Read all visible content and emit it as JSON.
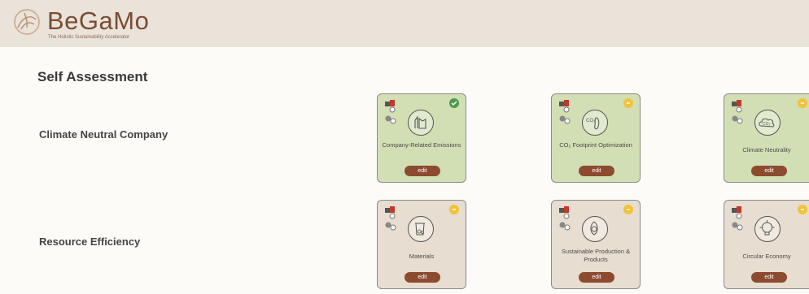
{
  "header": {
    "brand": "BeGaMo",
    "tagline": "The Holistic Sustainability Accelerator"
  },
  "page_title": "Self Assessment",
  "rows": [
    {
      "label": "Climate Neutral Company",
      "cards": [
        {
          "title": "Company-Related Emissions",
          "button": "edit",
          "status": "complete",
          "icon": "factory-icon"
        },
        {
          "title": "CO₂ Footprint Optimization",
          "button": "edit",
          "status": "pending",
          "icon": "footprint-icon"
        },
        {
          "title": "Climate Neutrality",
          "button": "edit",
          "status": "pending",
          "icon": "co2-cloud-icon"
        }
      ]
    },
    {
      "label": "Resource Efficiency",
      "cards": [
        {
          "title": "Materials",
          "button": "edit",
          "status": "pending",
          "icon": "bin-recycle-icon"
        },
        {
          "title": "Sustainable Production & Products",
          "button": "edit",
          "status": "pending",
          "icon": "leaf-recycle-icon"
        },
        {
          "title": "Circular Economy",
          "button": "edit",
          "status": "pending",
          "icon": "gear-bulb-icon"
        }
      ]
    }
  ],
  "colors": {
    "header_bg": "#e9e3d9",
    "brand": "#7a4c34",
    "card_green": "#d2dfb5",
    "card_beige": "#e7ddd0",
    "button": "#8c4b2f",
    "status_complete": "#4c9a4a",
    "status_pending": "#f0c33c"
  }
}
